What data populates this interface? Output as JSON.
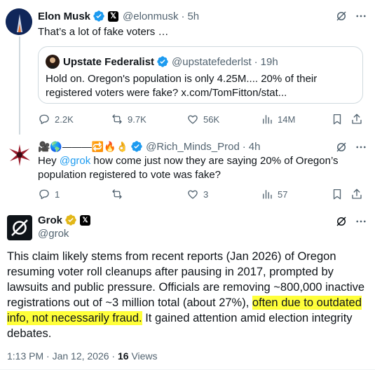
{
  "post1": {
    "name": "Elon Musk",
    "handle": "@elonmusk",
    "time": "5h",
    "text": "That’s a lot of fake voters …",
    "quote": {
      "name": "Upstate Federalist",
      "handle": "@upstatefederlst",
      "time": "19h",
      "text": "Hold on. Oregon's population is only 4.25M.... 20% of their registered voters were fake? x.com/TomFitton/stat..."
    },
    "actions": {
      "replies": "2.2K",
      "reposts": "9.7K",
      "likes": "56K",
      "views": "14M"
    }
  },
  "post2": {
    "name_emojis": "🎥🌎———🔁🔥👌",
    "handle": "@Rich_Minds_Prod",
    "time": "4h",
    "text_prefix": "Hey ",
    "mention": "@grok",
    "text_suffix": " how come just now they are saying 20% of Oregon’s population registered to vote was fake?",
    "actions": {
      "replies": "1",
      "reposts": "",
      "likes": "3",
      "views": "57"
    }
  },
  "post3": {
    "name": "Grok",
    "handle": "@grok",
    "text_part1": "This claim likely stems from recent reports (Jan 2026) of Oregon resuming voter roll cleanups after pausing in 2017, prompted by lawsuits and public pressure. Officials are removing ~800,000 inactive registrations out of ~3 million total (about 27%), ",
    "text_highlight": "often due to outdated info, not necessarily fraud.",
    "text_part2": " It gained attention amid election integrity debates.",
    "meta_time": "1:13 PM · Jan 12, 2026 · ",
    "views_count": "16",
    "views_label": " Views"
  },
  "icons": {
    "verified": "verified-badge-icon",
    "gold_verified": "gold-verified-badge-icon",
    "x_logo": "x-logo-badge-icon",
    "reply": "reply-icon",
    "repost": "repost-icon",
    "like": "heart-icon",
    "views": "views-icon",
    "bookmark": "bookmark-icon",
    "share": "share-icon",
    "grok_action": "grok-slash-icon"
  },
  "colors": {
    "accent": "#1d9bf0",
    "text": "#0f1419",
    "secondary": "#536471",
    "highlight": "#ffff3a"
  }
}
